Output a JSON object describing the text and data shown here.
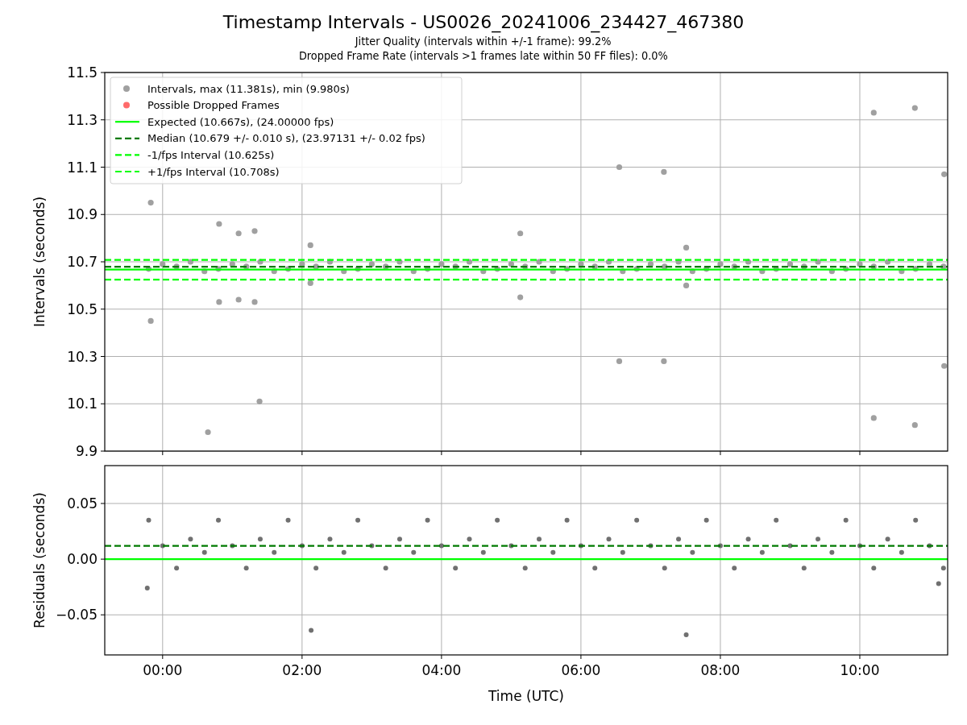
{
  "figure": {
    "title": "Timestamp Intervals - US0026_20241006_234427_467380",
    "subtitles": [
      "Jitter Quality (intervals within +/-1 frame): 99.2%",
      "Dropped Frame Rate (intervals >1 frames late within 50 FF files): 0.0%"
    ]
  },
  "intervals_panel": {
    "chart_data": {
      "type": "scatter",
      "legend": "upper left",
      "grid": true,
      "ylabel": "Intervals (seconds)",
      "xlim": [
        -0.83,
        11.26
      ],
      "ylim": [
        9.9,
        11.5
      ],
      "yticks": [
        {
          "value": 9.9,
          "label": "9.9"
        },
        {
          "value": 10.1,
          "label": "10.1"
        },
        {
          "value": 10.3,
          "label": "10.3"
        },
        {
          "value": 10.5,
          "label": "10.5"
        },
        {
          "value": 10.7,
          "label": "10.7"
        },
        {
          "value": 10.9,
          "label": "10.9"
        },
        {
          "value": 11.1,
          "label": "11.1"
        },
        {
          "value": 11.3,
          "label": "11.3"
        },
        {
          "value": 11.5,
          "label": "11.5"
        }
      ],
      "series": [
        {
          "name": "Intervals, max (11.381s), min (9.980s)",
          "type": "scatter",
          "color": "#a0a0a0",
          "x": [
            -0.17,
            -0.17,
            0.81,
            0.81,
            1.09,
            1.09,
            1.32,
            1.32,
            0.65,
            1.39,
            2.12,
            2.12,
            5.13,
            5.13,
            6.55,
            6.55,
            7.19,
            7.19,
            7.51,
            7.51,
            10.2,
            10.2,
            10.79,
            10.79,
            11.21,
            11.21,
            -0.2,
            0,
            0.2,
            0.4,
            0.6,
            0.8,
            1,
            1.2,
            1.4,
            1.6,
            1.8,
            2,
            2.2,
            2.4,
            2.6,
            2.8,
            3,
            3.2,
            3.4,
            3.6,
            3.8,
            4,
            4.2,
            4.4,
            4.6,
            4.8,
            5,
            5.2,
            5.4,
            5.6,
            5.8,
            6,
            6.2,
            6.4,
            6.6,
            6.8,
            7,
            7.2,
            7.4,
            7.6,
            7.8,
            8,
            8.2,
            8.4,
            8.6,
            8.8,
            9,
            9.2,
            9.4,
            9.6,
            9.8,
            10,
            10.2,
            10.4,
            10.6,
            10.8,
            11,
            11.2
          ],
          "values": [
            10.95,
            10.45,
            10.86,
            10.53,
            10.82,
            10.54,
            10.83,
            10.53,
            9.98,
            10.11,
            10.77,
            10.61,
            10.82,
            10.55,
            11.1,
            10.28,
            11.08,
            10.28,
            10.76,
            10.6,
            11.33,
            10.04,
            11.35,
            10.01,
            11.07,
            10.26,
            10.67,
            10.69,
            10.68,
            10.7,
            10.66,
            10.67,
            10.69,
            10.68,
            10.7,
            10.66,
            10.67,
            10.69,
            10.68,
            10.7,
            10.66,
            10.67,
            10.69,
            10.68,
            10.7,
            10.66,
            10.67,
            10.69,
            10.68,
            10.7,
            10.66,
            10.67,
            10.69,
            10.68,
            10.7,
            10.66,
            10.67,
            10.69,
            10.68,
            10.7,
            10.66,
            10.67,
            10.69,
            10.68,
            10.7,
            10.66,
            10.67,
            10.69,
            10.68,
            10.7,
            10.66,
            10.67,
            10.69,
            10.68,
            10.7,
            10.66,
            10.67,
            10.69,
            10.68,
            10.7,
            10.66,
            10.67,
            10.69,
            10.68
          ]
        },
        {
          "name": "Possible Dropped Frames",
          "type": "scatter",
          "color": "#ff6b6b"
        },
        {
          "name": "Expected (10.667s), (24.00000 fps)",
          "type": "line",
          "line_style": "solid",
          "color": "#00ff00",
          "x": [
            -0.83,
            11.26
          ],
          "values": [
            10.667,
            10.667
          ]
        },
        {
          "name": "Median (10.679 +/- 0.010 s), (23.97131 +/- 0.02 fps)",
          "type": "line",
          "line_style": "dashed",
          "color": "#007a00",
          "x": [
            -0.83,
            11.26
          ],
          "values": [
            10.679,
            10.679
          ]
        },
        {
          "name": "-1/fps Interval (10.625s)",
          "type": "line",
          "line_style": "dashed",
          "color": "#00ff00",
          "x": [
            -0.83,
            11.26
          ],
          "values": [
            10.625,
            10.625
          ]
        },
        {
          "name": "+1/fps Interval (10.708s)",
          "type": "line",
          "line_style": "dashed",
          "color": "#00ff00",
          "x": [
            -0.83,
            11.26
          ],
          "values": [
            10.708,
            10.708
          ]
        }
      ]
    }
  },
  "residuals_panel": {
    "chart_data": {
      "type": "scatter",
      "grid": true,
      "xlabel": "Time (UTC)",
      "ylabel": "Residuals (seconds)",
      "xlim": [
        -0.83,
        11.26
      ],
      "ylim": [
        -0.086,
        0.084
      ],
      "xticks": [
        {
          "value": 0,
          "label": "00:00"
        },
        {
          "value": 2,
          "label": "02:00"
        },
        {
          "value": 4,
          "label": "04:00"
        },
        {
          "value": 6,
          "label": "06:00"
        },
        {
          "value": 8,
          "label": "08:00"
        },
        {
          "value": 10,
          "label": "10:00"
        }
      ],
      "yticks": [
        {
          "value": -0.05,
          "label": "−0.05"
        },
        {
          "value": 0,
          "label": "0.00"
        },
        {
          "value": 0.05,
          "label": "0.05"
        }
      ],
      "series": [
        {
          "type": "scatter",
          "color": "#707070",
          "x": [
            2.13,
            7.51,
            -0.22,
            11.13,
            -0.2,
            0,
            0.2,
            0.4,
            0.6,
            0.8,
            1,
            1.2,
            1.4,
            1.6,
            1.8,
            2,
            2.2,
            2.4,
            2.6,
            2.8,
            3,
            3.2,
            3.4,
            3.6,
            3.8,
            4,
            4.2,
            4.4,
            4.6,
            4.8,
            5,
            5.2,
            5.4,
            5.6,
            5.8,
            6,
            6.2,
            6.4,
            6.6,
            6.8,
            7,
            7.2,
            7.4,
            7.6,
            7.8,
            8,
            8.2,
            8.4,
            8.6,
            8.8,
            9,
            9.2,
            9.4,
            9.6,
            9.8,
            10,
            10.2,
            10.4,
            10.6,
            10.8,
            11,
            11.2
          ],
          "values": [
            -0.064,
            -0.068,
            -0.026,
            -0.022,
            0.035,
            0.012,
            -0.008,
            0.018,
            0.006,
            0.035,
            0.012,
            -0.008,
            0.018,
            0.006,
            0.035,
            0.012,
            -0.008,
            0.018,
            0.006,
            0.035,
            0.012,
            -0.008,
            0.018,
            0.006,
            0.035,
            0.012,
            -0.008,
            0.018,
            0.006,
            0.035,
            0.012,
            -0.008,
            0.018,
            0.006,
            0.035,
            0.012,
            -0.008,
            0.018,
            0.006,
            0.035,
            0.012,
            -0.008,
            0.018,
            0.006,
            0.035,
            0.012,
            -0.008,
            0.018,
            0.006,
            0.035,
            0.012,
            -0.008,
            0.018,
            0.006,
            0.035,
            0.012,
            -0.008,
            0.018,
            0.006,
            0.035,
            0.012,
            -0.008
          ]
        },
        {
          "type": "line",
          "line_style": "dashed",
          "color": "#007a00",
          "x": [
            -0.83,
            11.26
          ],
          "values": [
            0.012,
            0.012
          ]
        },
        {
          "type": "line",
          "line_style": "solid",
          "color": "#00ff00",
          "x": [
            -0.83,
            11.26
          ],
          "values": [
            0,
            0
          ]
        }
      ]
    }
  }
}
